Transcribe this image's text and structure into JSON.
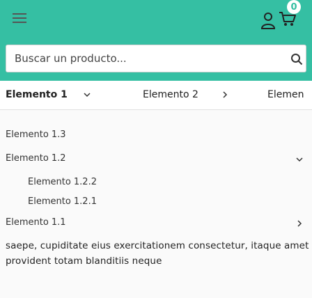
{
  "header": {
    "cart_count": "0",
    "brand_color": "#35bfa3",
    "icons": [
      "hamburger-icon",
      "user-icon",
      "cart-icon",
      "search-icon"
    ]
  },
  "search": {
    "placeholder": "Buscar un producto..."
  },
  "topnav": {
    "items": [
      {
        "label": "Elemento 1"
      },
      {
        "label": "Elemento 2"
      },
      {
        "label": "Elemen"
      }
    ]
  },
  "menu": {
    "items": [
      {
        "label": "Elemento 1.3"
      },
      {
        "label": "Elemento 1.2"
      },
      {
        "label": "Elemento 1.2.2"
      },
      {
        "label": "Elemento 1.2.1"
      },
      {
        "label": "Elemento 1.1"
      }
    ]
  },
  "body": {
    "text": "saepe, cupiditate eius exercitationem consectetur, itaque amet provident totam blanditiis neque"
  }
}
